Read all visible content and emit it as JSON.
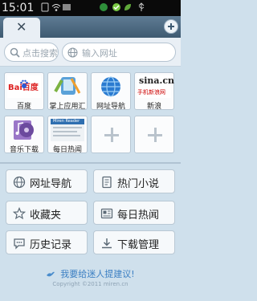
{
  "status_bar": {
    "time": "15:01"
  },
  "search": {
    "search_placeholder": "点击搜索",
    "url_placeholder": "输入网址"
  },
  "speed_dial": [
    {
      "label": "百度",
      "logo_text": "Bai百度"
    },
    {
      "label": "掌上应用汇"
    },
    {
      "label": "网址导航"
    },
    {
      "label": "新浪",
      "logo_text": "sina.cn",
      "logo_subtext": "手机新浪网"
    },
    {
      "label": "音乐下载"
    },
    {
      "label": "每日热闻",
      "logo_text": "Miren Reader"
    }
  ],
  "menu": {
    "nav": "网址导航",
    "novel": "热门小说",
    "favorites": "收藏夹",
    "daily": "每日热闻",
    "history": "历史记录",
    "downloads": "下载管理"
  },
  "footer": {
    "suggest": "我要给迷人提建议!",
    "copyright": "Copyright ©2011 miren.cn"
  }
}
